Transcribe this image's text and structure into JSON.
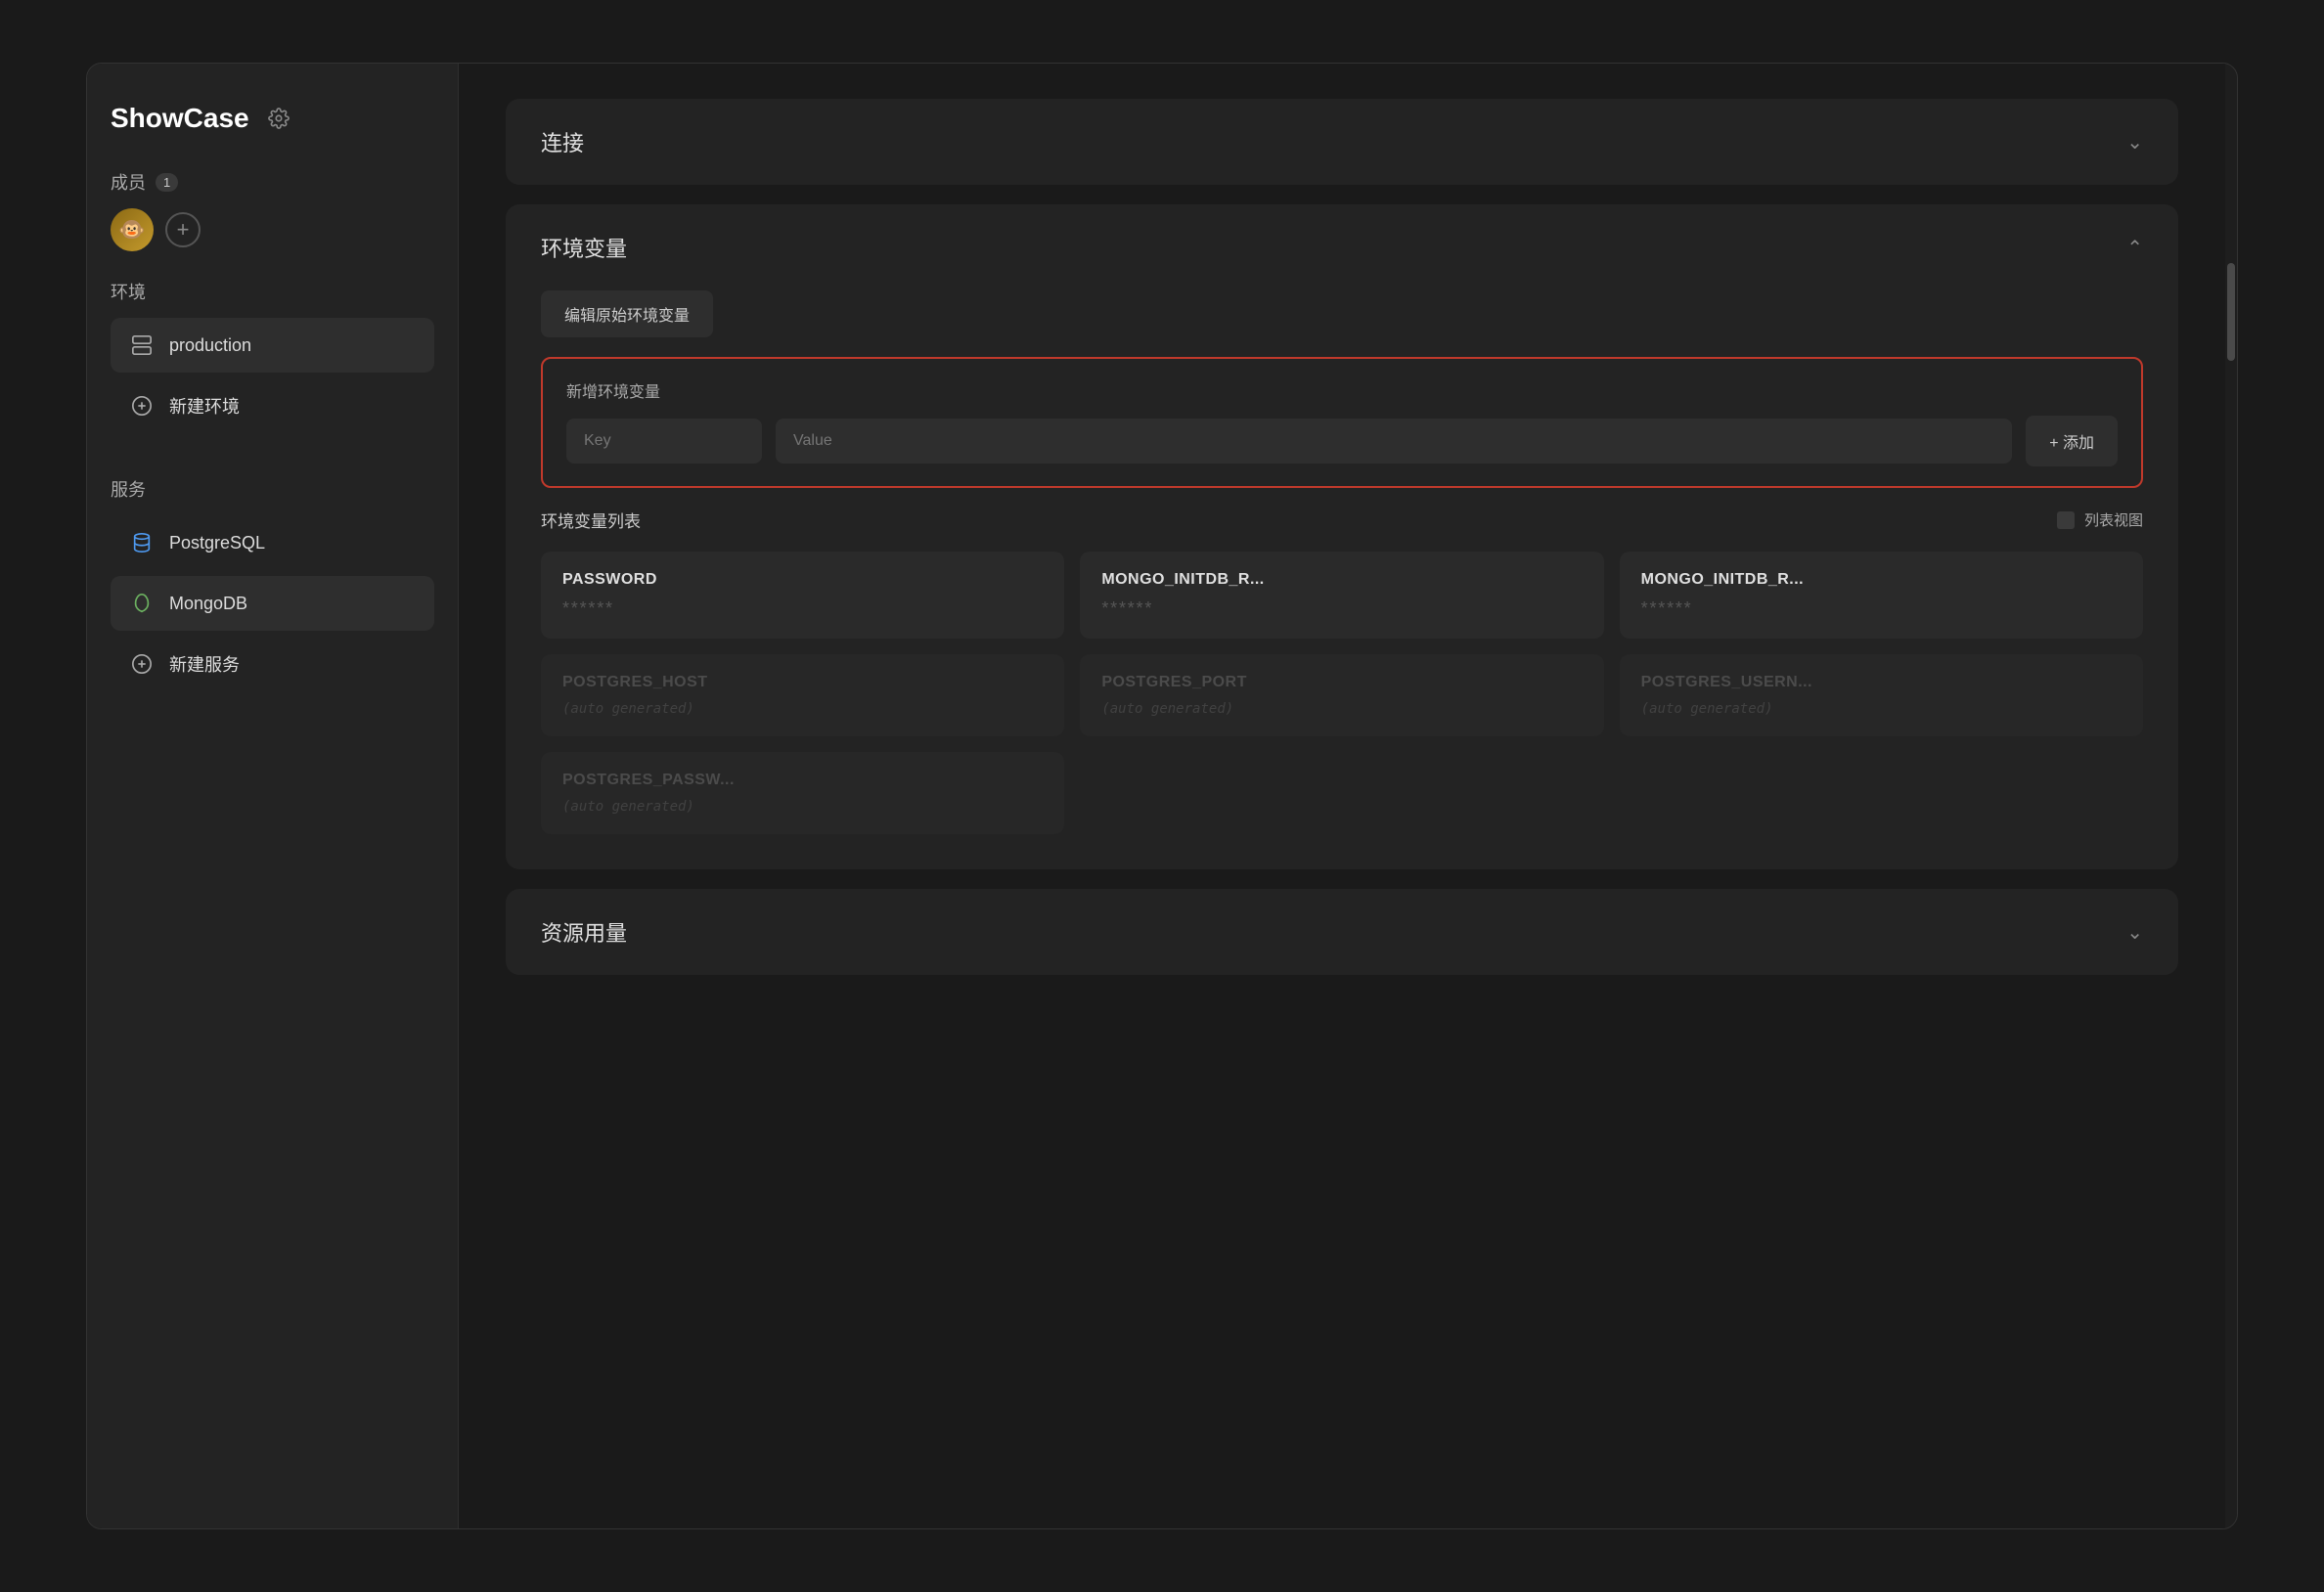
{
  "app": {
    "title": "ShowCase"
  },
  "sidebar": {
    "members_label": "成员",
    "members_count": "1",
    "env_label": "环境",
    "env_items": [
      {
        "id": "production",
        "label": "production",
        "active": true
      }
    ],
    "new_env_label": "新建环境",
    "services_label": "服务",
    "service_items": [
      {
        "id": "postgresql",
        "label": "PostgreSQL"
      },
      {
        "id": "mongodb",
        "label": "MongoDB",
        "active": true
      }
    ],
    "new_service_label": "新建服务"
  },
  "main": {
    "connection_section": {
      "title": "连接",
      "collapsed": true
    },
    "env_section": {
      "title": "环境变量",
      "expanded": true,
      "edit_raw_label": "编辑原始环境变量",
      "new_env_form": {
        "title": "新增环境变量",
        "key_placeholder": "Key",
        "value_placeholder": "Value",
        "add_button": "+ 添加"
      },
      "env_list_label": "环境变量列表",
      "list_view_label": "列表视图",
      "env_cards": [
        {
          "key": "PASSWORD",
          "value": "******",
          "auto": false,
          "dimmed": false
        },
        {
          "key": "MONGO_INITDB_R...",
          "value": "******",
          "auto": false,
          "dimmed": false
        },
        {
          "key": "MONGO_INITDB_R...",
          "value": "******",
          "auto": false,
          "dimmed": false
        },
        {
          "key": "POSTGRES_HOST",
          "value": "",
          "auto": true,
          "auto_text": "(auto generated)",
          "dimmed": true
        },
        {
          "key": "POSTGRES_PORT",
          "value": "",
          "auto": true,
          "auto_text": "(auto generated)",
          "dimmed": true
        },
        {
          "key": "POSTGRES_USERN...",
          "value": "",
          "auto": true,
          "auto_text": "(auto generated)",
          "dimmed": true
        },
        {
          "key": "POSTGRES_PASSW...",
          "value": "",
          "auto": true,
          "auto_text": "(auto generated)",
          "dimmed": true
        }
      ]
    },
    "resource_section": {
      "title": "资源用量",
      "collapsed": true
    }
  }
}
